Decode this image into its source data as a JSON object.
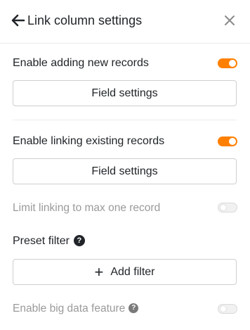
{
  "header": {
    "title": "Link column settings",
    "back_icon": "arrow-left-icon",
    "close_icon": "close-icon"
  },
  "settings": {
    "enable_adding": {
      "label": "Enable adding new records",
      "enabled": true,
      "button_label": "Field settings"
    },
    "enable_linking": {
      "label": "Enable linking existing records",
      "enabled": true,
      "button_label": "Field settings"
    },
    "limit_linking": {
      "label": "Limit linking to max one record",
      "enabled": false
    },
    "preset_filter": {
      "label": "Preset filter",
      "help_glyph": "?",
      "add_filter_label": "Add filter",
      "add_glyph": "+"
    },
    "big_data": {
      "label": "Enable big data feature",
      "help_glyph": "?",
      "enabled": false
    }
  },
  "colors": {
    "accent": "#ff8000",
    "text": "#212529",
    "disabled_text": "#9a9a9a"
  }
}
